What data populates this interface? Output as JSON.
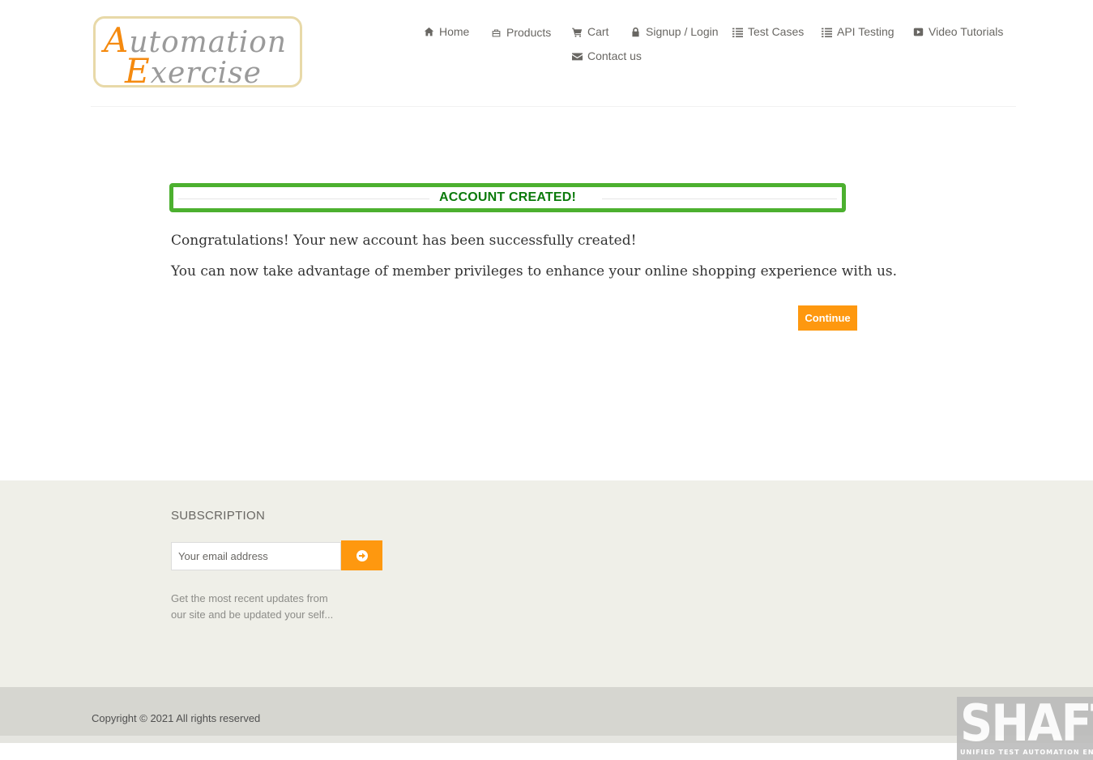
{
  "logo": {
    "line1_cap": "A",
    "line1_rest": "utomation",
    "line2_cap": "E",
    "line2_rest": "xercise"
  },
  "nav": {
    "home": "Home",
    "products": "Products",
    "cart": "Cart",
    "signup_login": "Signup / Login",
    "test_cases": "Test Cases",
    "api_testing": "API Testing",
    "video_tutorials": "Video Tutorials",
    "contact_us": "Contact us"
  },
  "main": {
    "title": "ACCOUNT CREATED!",
    "message1": "Congratulations! Your new account has been successfully created!",
    "message2": "You can now take advantage of member privileges to enhance your online shopping experience with us.",
    "continue_label": "Continue"
  },
  "footer": {
    "subscription_title": "SUBSCRIPTION",
    "email_placeholder": "Your email address",
    "description": "Get the most recent updates from our site and be updated your self...",
    "copyright": "Copyright © 2021 All rights reserved"
  },
  "watermark": {
    "title": "SHAFT",
    "subtitle": "UNIFIED TEST AUTOMATION ENGINE"
  },
  "colors": {
    "accent": "#fe980f",
    "success_border": "#4cb02f",
    "success_text": "#0b7a0b"
  }
}
